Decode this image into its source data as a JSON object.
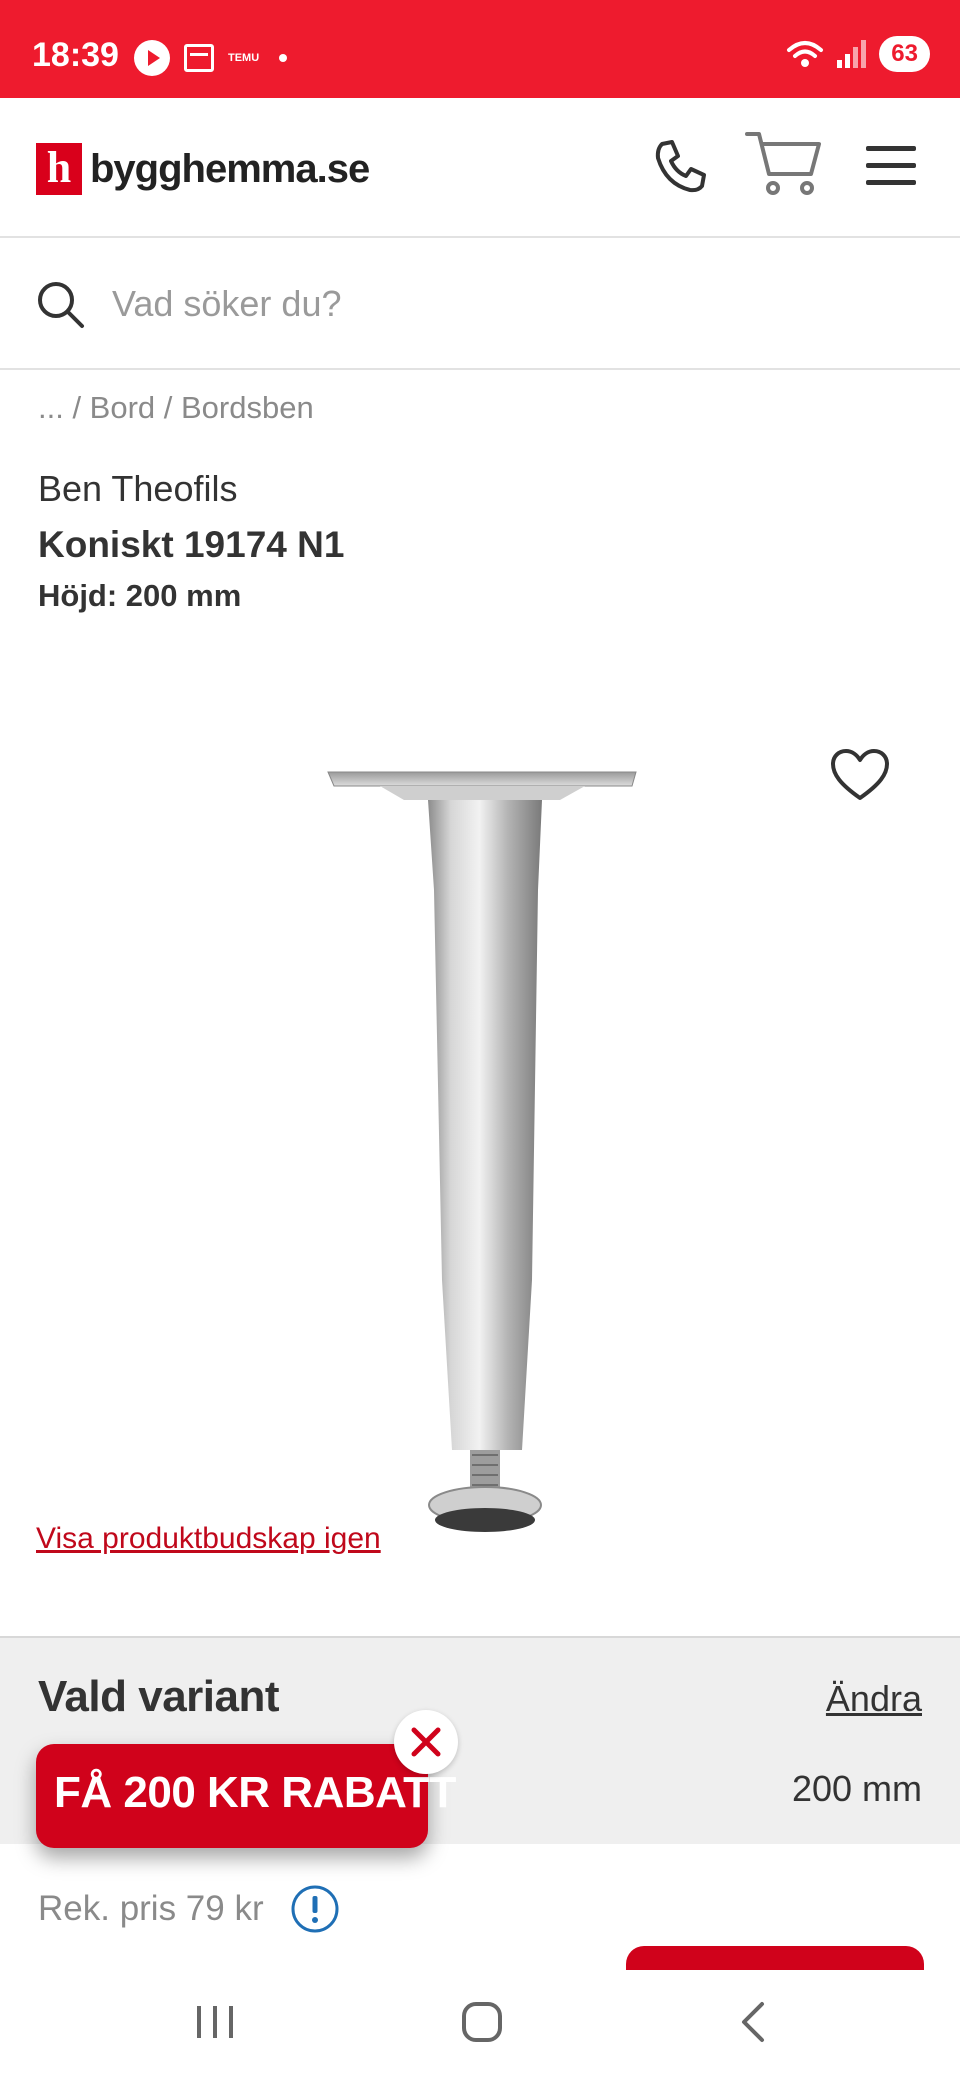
{
  "status_bar": {
    "time": "18:39",
    "temu_label": "TEMU",
    "battery": "63",
    "icons": [
      "play-icon",
      "calendar-icon",
      "temu-icon",
      "wifi-icon",
      "signal-icon",
      "battery-icon"
    ]
  },
  "header": {
    "logo_mark": "h",
    "logo_text": "bygghemma.se",
    "icons": [
      "phone-icon",
      "cart-icon",
      "menu-icon"
    ]
  },
  "search": {
    "placeholder": "Vad söker du?",
    "value": ""
  },
  "breadcrumb": "... / Bord / Bordsben",
  "product": {
    "brand": "Ben Theofils",
    "name": "Koniskt 19174 N1",
    "height_label": "Höjd: 200 mm"
  },
  "product_message_link": "Visa produktbudskap igen",
  "variant": {
    "title": "Vald variant",
    "change_label": "Ändra",
    "value": "200 mm"
  },
  "promo": {
    "label": "FÅ 200 KR RABATT"
  },
  "price": {
    "recommended": "Rek. pris 79 kr"
  },
  "colors": {
    "brand_red": "#ee1b2e",
    "promo_red": "#d0021b",
    "link_red": "#c0081b",
    "info_blue": "#1f6fb5"
  }
}
